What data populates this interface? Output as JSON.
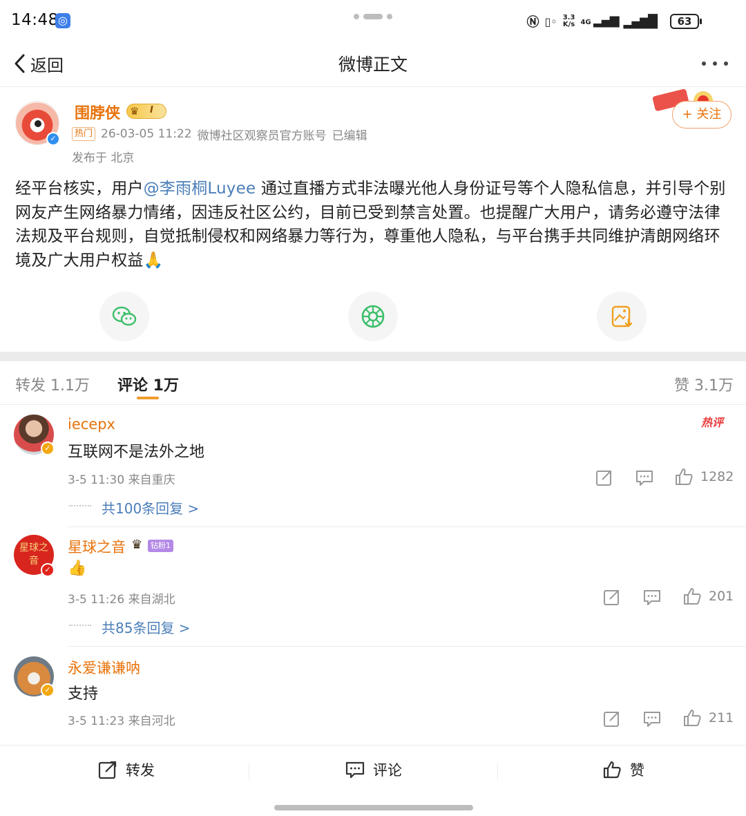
{
  "status_bar": {
    "time": "14:48",
    "network_speed_top": "3.3",
    "network_speed_bottom": "K/s",
    "network_type": "4G",
    "battery": "63"
  },
  "nav": {
    "back_label": "返回",
    "title": "微博正文"
  },
  "post": {
    "author": "围脖侠",
    "vip_level": "I",
    "hot_tag": "热门",
    "timestamp": "26-03-05 11:22",
    "source": "微博社区观察员官方账号",
    "edited": "已编辑",
    "location": "发布于 北京",
    "follow_label": "+ 关注",
    "text_before": "经平台核实，用户",
    "mention": "@李雨桐Luyee",
    "text_after": " 通过直播方式非法曝光他人身份证号等个人隐私信息，并引导个别网友产生网络暴力情绪，因违反社区公约，目前已受到禁言处置。也提醒广大用户，请务必遵守法律法规及平台规则，自觉抵制侵权和网络暴力等行为，尊重他人隐私，与平台携手共同维护清朗网络环境及广大用户权益🙏"
  },
  "tabs": {
    "repost": "转发 1.1万",
    "comment": "评论 1万",
    "like": "赞 3.1万"
  },
  "comments": [
    {
      "name": "iecepx",
      "text": "互联网不是法外之地",
      "meta": "3-5 11:30 来自重庆",
      "likes": "1282",
      "replies": "共100条回复 >",
      "badge": "热评"
    },
    {
      "name": "星球之音",
      "text": "👍",
      "meta": "3-5 11:26 来自湖北",
      "likes": "201",
      "replies": "共85条回复 >",
      "badge": "钻粉1",
      "avatar_text": "星球之音"
    },
    {
      "name": "永爱谦谦呐",
      "text": "支持",
      "meta": "3-5 11:23 来自河北",
      "likes": "211"
    }
  ],
  "bottom_bar": {
    "repost": "转发",
    "comment": "评论",
    "like": "赞"
  },
  "colors": {
    "accent_orange": "#e8730c",
    "link_blue": "#4b7eb8",
    "muted": "#888888"
  }
}
